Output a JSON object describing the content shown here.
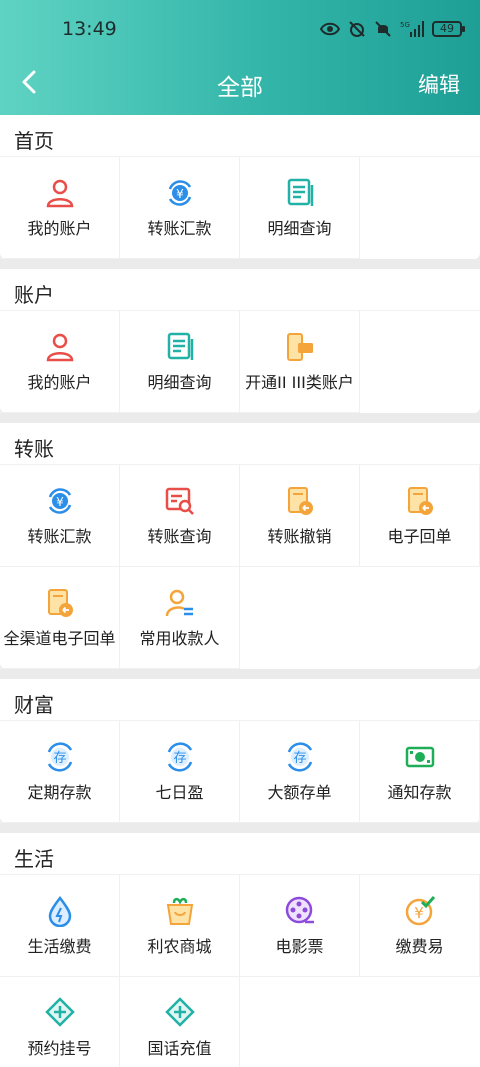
{
  "status": {
    "time": "13:49",
    "battery": "49",
    "signal": "5G"
  },
  "nav": {
    "title": "全部",
    "edit": "编辑"
  },
  "sections": [
    {
      "title": "首页",
      "items": [
        {
          "label": "我的账户",
          "icon": "person-icon"
        },
        {
          "label": "转账汇款",
          "icon": "yuan-transfer-icon"
        },
        {
          "label": "明细查询",
          "icon": "document-list-icon"
        }
      ]
    },
    {
      "title": "账户",
      "items": [
        {
          "label": "我的账户",
          "icon": "person-icon"
        },
        {
          "label": "明细查询",
          "icon": "document-list-icon"
        },
        {
          "label": "开通II III类账户",
          "icon": "card-phone-icon"
        }
      ]
    },
    {
      "title": "转账",
      "items": [
        {
          "label": "转账汇款",
          "icon": "yuan-transfer-icon"
        },
        {
          "label": "转账查询",
          "icon": "doc-search-icon"
        },
        {
          "label": "转账撤销",
          "icon": "receipt-undo-icon"
        },
        {
          "label": "电子回单",
          "icon": "receipt-undo-icon"
        },
        {
          "label": "全渠道电子回单",
          "icon": "receipt-undo-icon"
        },
        {
          "label": "常用收款人",
          "icon": "payee-icon"
        }
      ]
    },
    {
      "title": "财富",
      "items": [
        {
          "label": "定期存款",
          "icon": "deposit-icon"
        },
        {
          "label": "七日盈",
          "icon": "deposit-icon"
        },
        {
          "label": "大额存单",
          "icon": "deposit-icon"
        },
        {
          "label": "通知存款",
          "icon": "cash-note-icon"
        }
      ]
    },
    {
      "title": "生活",
      "items": [
        {
          "label": "生活缴费",
          "icon": "water-drop-icon"
        },
        {
          "label": "利农商城",
          "icon": "shopping-bag-icon"
        },
        {
          "label": "电影票",
          "icon": "film-reel-icon"
        },
        {
          "label": "缴费易",
          "icon": "yuan-check-icon"
        },
        {
          "label": "预约挂号",
          "icon": "medical-cross-icon"
        },
        {
          "label": "国话充值",
          "icon": "medical-cross-icon"
        }
      ]
    }
  ],
  "colors": {
    "header_start": "#5fd3c3",
    "header_end": "#1e9f96",
    "red": "#e84d48",
    "blue": "#2b8ee8",
    "teal": "#22b1a6",
    "orange": "#f3a43a"
  }
}
